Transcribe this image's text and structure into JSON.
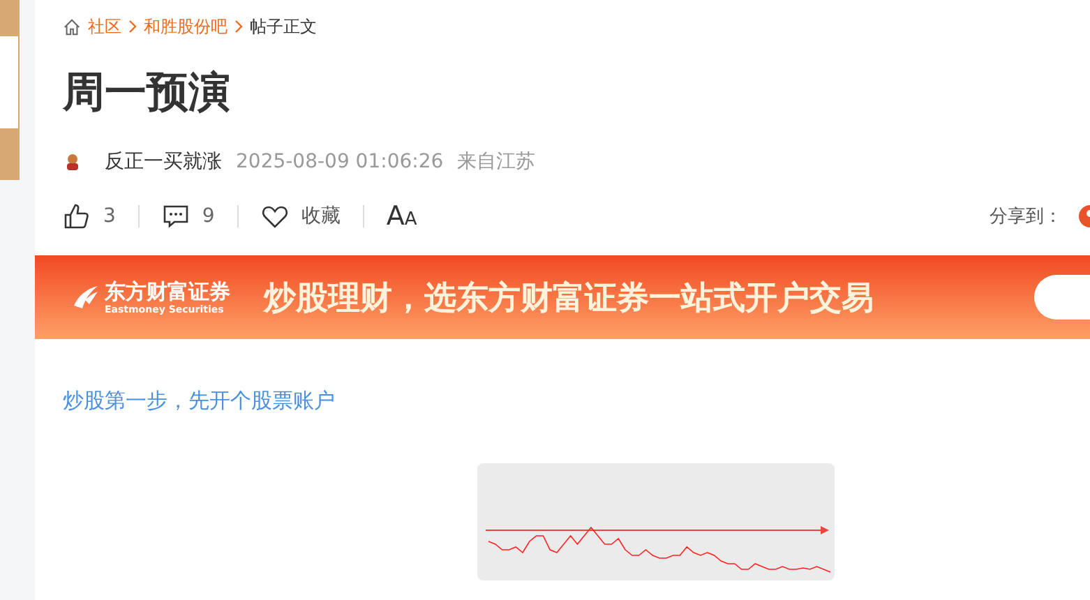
{
  "breadcrumb": [
    {
      "label": "社区",
      "kind": "link"
    },
    {
      "label": "和胜股份吧",
      "kind": "link"
    },
    {
      "label": "帖子正文",
      "kind": "current"
    }
  ],
  "post": {
    "title": "周一预演",
    "author": "反正一买就涨",
    "time": "2025-08-09 01:06:26",
    "location": "来自江苏"
  },
  "actions": {
    "likes": "3",
    "comments": "9",
    "favorite": "收藏",
    "font_big": "A",
    "font_small": "A",
    "share_label": "分享到："
  },
  "banner": {
    "brand": "东方财富证券",
    "brand_en": "Eastmoney Securities",
    "slogan": "炒股理财，选东方财富证券一站式开户交易"
  },
  "body": {
    "link": "炒股第一步，先开个股票账户"
  }
}
